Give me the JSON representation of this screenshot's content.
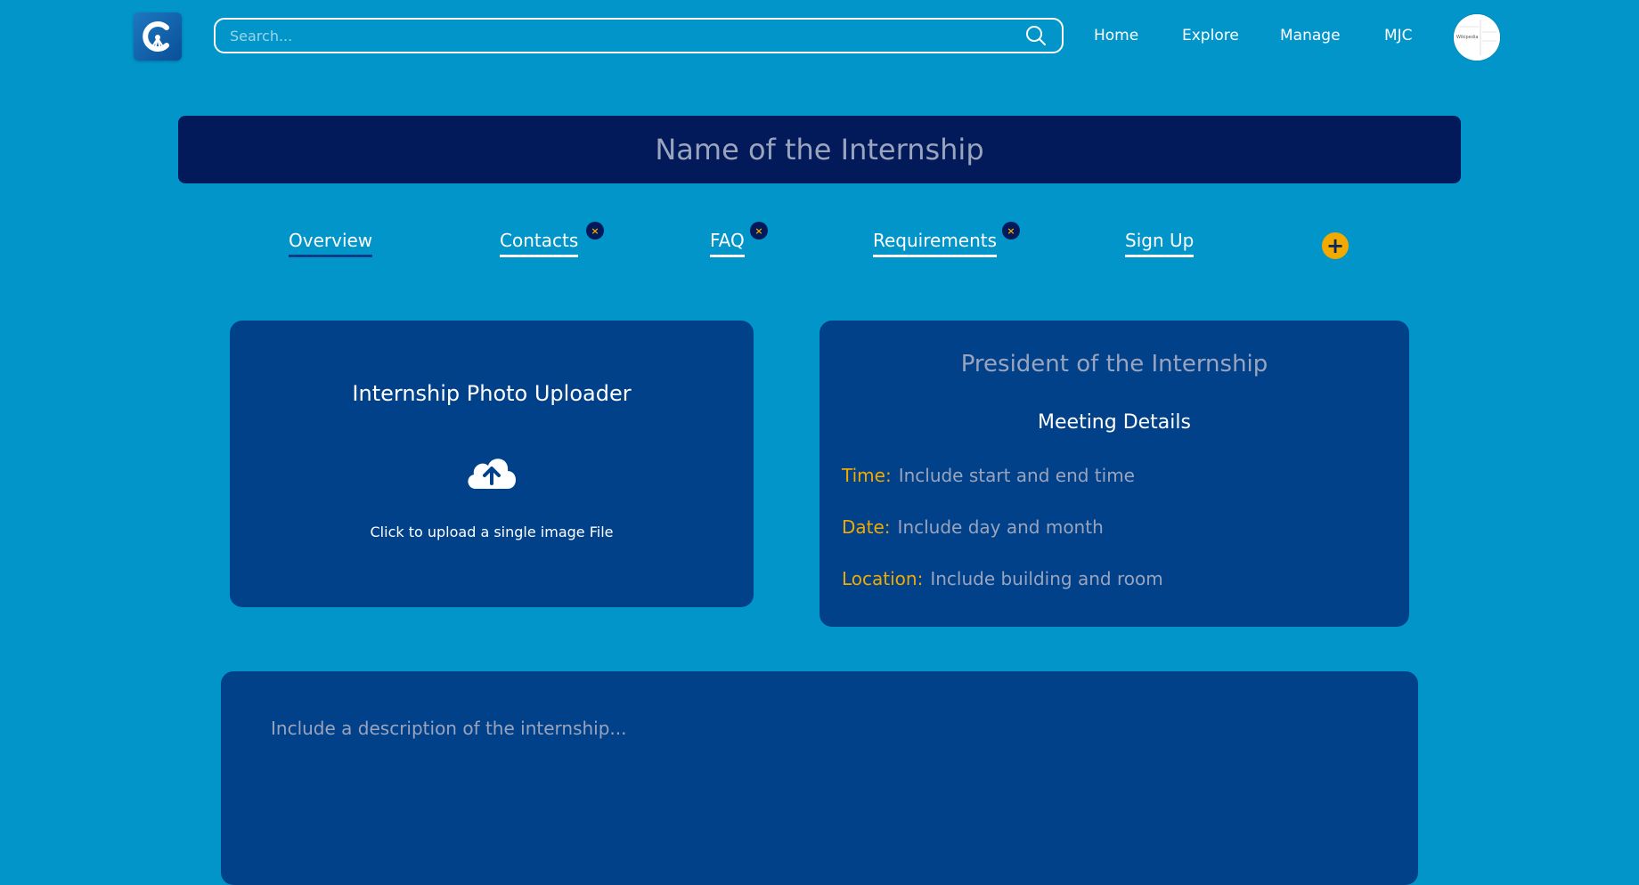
{
  "header": {
    "search_placeholder": "Search...",
    "nav": [
      "Home",
      "Explore",
      "Manage",
      "MJC"
    ],
    "avatar_text": "Wikipedia"
  },
  "title_placeholder": "Name of the Internship",
  "tabs": [
    {
      "label": "Overview",
      "active": true,
      "closable": false
    },
    {
      "label": "Contacts",
      "active": false,
      "closable": true
    },
    {
      "label": "FAQ",
      "active": false,
      "closable": true
    },
    {
      "label": "Requirements",
      "active": false,
      "closable": true
    },
    {
      "label": "Sign Up",
      "active": false,
      "closable": false
    }
  ],
  "tab_close_glyph": "×",
  "add_tab_glyph": "+",
  "uploader": {
    "title": "Internship Photo Uploader",
    "hint": "Click to upload a single image File"
  },
  "details": {
    "president": "President of the Internship",
    "meeting_title": "Meeting Details",
    "time_label": "Time:",
    "time_value": "Include start and end time",
    "date_label": "Date:",
    "date_value": "Include day and month",
    "location_label": "Location:",
    "location_value": "Include building and room"
  },
  "description_placeholder": "Include a description of the internship...",
  "colors": {
    "background": "#0295CA",
    "title_bar": "#021A5A",
    "card": "#01418A",
    "accent": "#F2A900",
    "muted_text": "#9aa4bd"
  }
}
